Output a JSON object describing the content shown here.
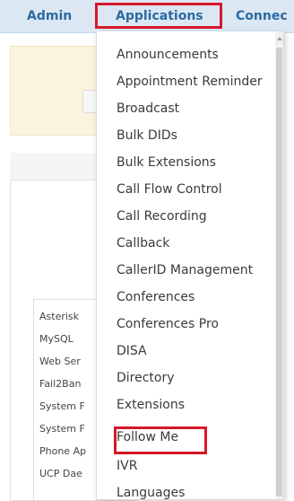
{
  "topnav": {
    "items": [
      {
        "label": "Admin"
      },
      {
        "label": "Applications"
      },
      {
        "label": "Connec"
      }
    ]
  },
  "background": {
    "rows": [
      "Asterisk",
      "MySQL",
      "Web Ser",
      "Fail2Ban",
      "System F",
      "System F",
      "Phone Ap",
      "UCP Dae"
    ]
  },
  "applications_menu": {
    "items": [
      "Announcements",
      "Appointment Reminder",
      "Broadcast",
      "Bulk DIDs",
      "Bulk Extensions",
      "Call Flow Control",
      "Call Recording",
      "Callback",
      "CallerID Management",
      "Conferences",
      "Conferences Pro",
      "DISA",
      "Directory",
      "Extensions",
      "Follow Me",
      "IVR",
      "Languages"
    ]
  },
  "colors": {
    "nav_bg": "#dbe8f3",
    "nav_text": "#2c6aa0",
    "highlight_border": "#d7182a"
  }
}
